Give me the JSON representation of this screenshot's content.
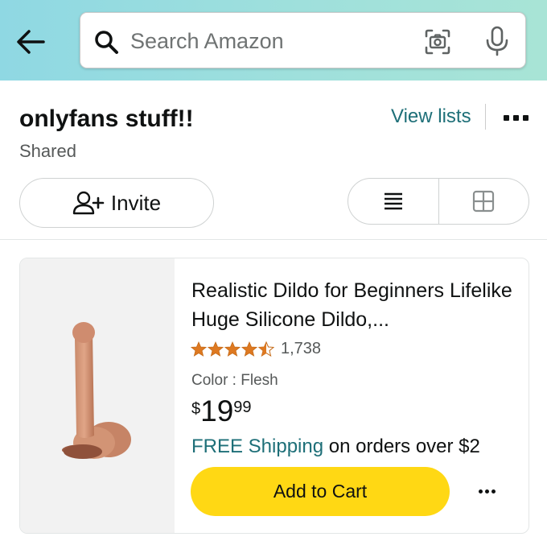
{
  "header": {
    "search_placeholder": "Search Amazon"
  },
  "list": {
    "title": "onlyfans stuff!!",
    "sharing_status": "Shared",
    "view_lists_label": "View lists",
    "invite_label": "Invite"
  },
  "product": {
    "title": "Realistic Dildo for Beginners Lifelike Huge Silicone Dildo,...",
    "rating": 4.5,
    "rating_count": "1,738",
    "color": "Color : Flesh",
    "price_symbol": "$",
    "price_whole": "19",
    "price_fraction": "99",
    "shipping_free": "FREE Shipping",
    "shipping_rest": " on orders over $2",
    "add_to_cart_label": "Add to Cart"
  },
  "colors": {
    "header_gradient_start": "#8fd8e3",
    "header_gradient_end": "#a8e4d6",
    "link": "#1e6f78",
    "star": "#de7921",
    "cart_button": "#ffd814"
  },
  "icons": [
    "back-arrow-icon",
    "search-icon",
    "camera-icon",
    "microphone-icon",
    "more-icon",
    "add-person-icon",
    "list-view-icon",
    "grid-view-icon",
    "star-icon"
  ]
}
